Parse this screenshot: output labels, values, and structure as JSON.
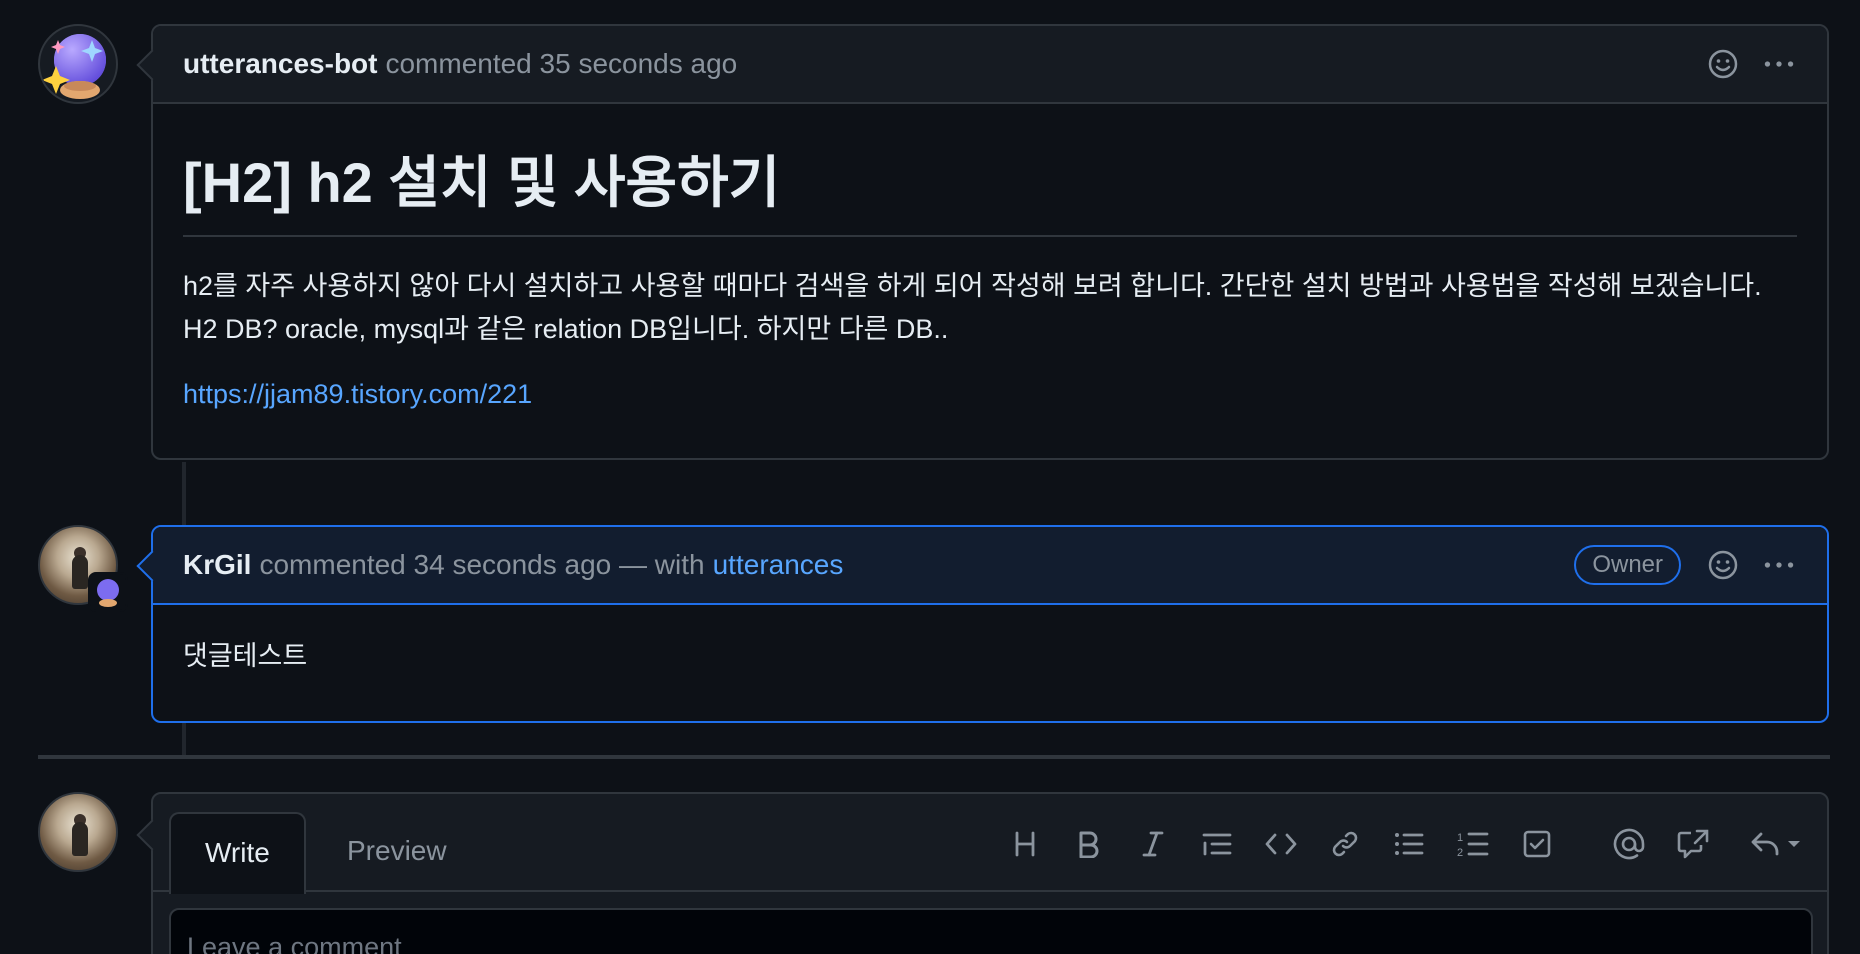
{
  "comments": [
    {
      "author": "utterances-bot",
      "meta": "commented 35 seconds ago",
      "title": "[H2] h2 설치 및 사용하기",
      "body": "h2를 자주 사용하지 않아 다시 설치하고 사용할 때마다 검색을 하게 되어 작성해 보려 합니다. 간단한 설치 방법과 사용법을 작성해 보겠습니다. H2 DB? oracle, mysql과 같은 relation DB입니다. 하지만 다른 DB..",
      "link": "https://jjam89.tistory.com/221"
    },
    {
      "author": "KrGil",
      "meta": "commented 34 seconds ago — with",
      "via": "utterances",
      "role": "Owner",
      "body": "댓글테스트"
    }
  ],
  "editor": {
    "tabs": [
      "Write",
      "Preview"
    ],
    "placeholder": "Leave a comment",
    "toolbar_icons": [
      "heading-icon",
      "bold-icon",
      "italic-icon",
      "quote-icon",
      "code-icon",
      "link-icon",
      "unordered-list-icon",
      "ordered-list-icon",
      "task-list-icon",
      "mention-icon",
      "cross-reference-icon",
      "reply-icon"
    ]
  },
  "colors": {
    "background": "#0d1117",
    "accent": "#58a6ff",
    "owner_border": "#1f6feb"
  }
}
